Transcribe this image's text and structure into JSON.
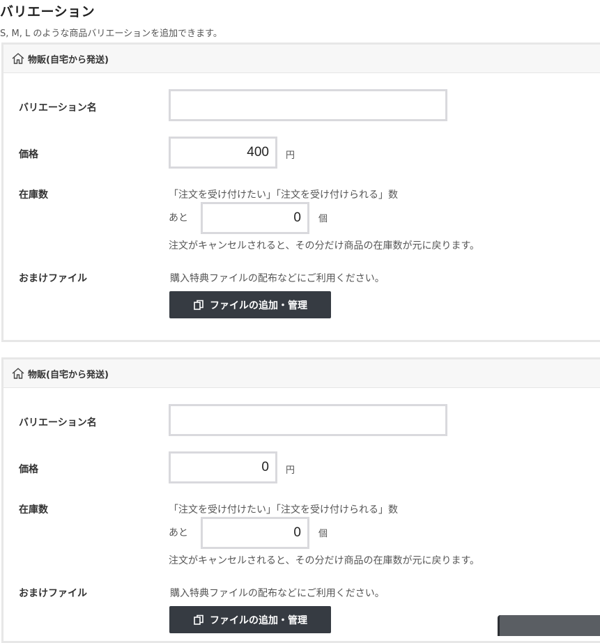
{
  "page": {
    "title": "バリエーション",
    "subtitle": "S, M, L のような商品バリエーションを追加できます。"
  },
  "variations": [
    {
      "header": "物販(自宅から発送)",
      "name_label": "バリエーション名",
      "name_value": "",
      "price_label": "価格",
      "price_value": "400",
      "price_unit": "円",
      "stock_label": "在庫数",
      "stock_note": "「注文を受け付けたい」「注文を受け付けられる」数",
      "stock_prefix": "あと",
      "stock_value": "0",
      "stock_unit": "個",
      "stock_footnote": "注文がキャンセルされると、その分だけ商品の在庫数が元に戻ります。",
      "bonus_label": "おまけファイル",
      "bonus_note": "購入特典ファイルの配布などにご利用ください。",
      "bonus_button": "ファイルの追加・管理"
    },
    {
      "header": "物販(自宅から発送)",
      "name_label": "バリエーション名",
      "name_value": "",
      "price_label": "価格",
      "price_value": "0",
      "price_unit": "円",
      "stock_label": "在庫数",
      "stock_note": "「注文を受け付けたい」「注文を受け付けられる」数",
      "stock_prefix": "あと",
      "stock_value": "0",
      "stock_unit": "個",
      "stock_footnote": "注文がキャンセルされると、その分だけ商品の在庫数が元に戻ります。",
      "bonus_label": "おまけファイル",
      "bonus_note": "購入特典ファイルの配布などにご利用ください。",
      "bonus_button": "ファイルの追加・管理"
    }
  ],
  "icons": {
    "header_icon": "home-icon",
    "button_icon": "copy-icon"
  },
  "colors": {
    "button_bg": "#363b42",
    "input_border": "#d9d9dd",
    "header_bg": "#f7f7f7"
  }
}
